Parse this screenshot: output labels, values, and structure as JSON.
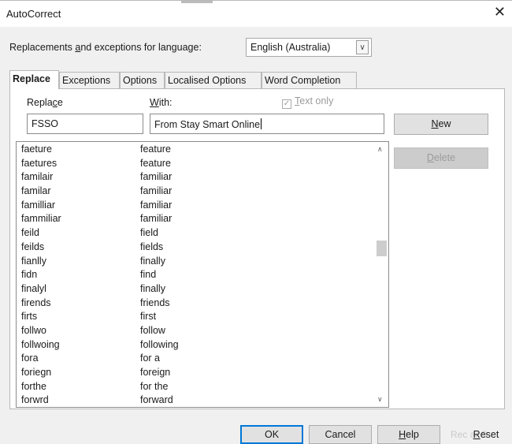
{
  "window": {
    "title": "AutoCorrect",
    "close_glyph": "✕"
  },
  "language": {
    "label_pre": "Replacements ",
    "label_mn": "a",
    "label_post": "nd exceptions for language:",
    "selected": "English (Australia)"
  },
  "tabs": [
    {
      "label": "Replace",
      "active": true
    },
    {
      "label": "Exceptions",
      "active": false
    },
    {
      "label": "Options",
      "active": false
    },
    {
      "label": "Localised Options",
      "active": false
    },
    {
      "label": "Word Completion",
      "active": false
    }
  ],
  "replace": {
    "replace_label_pre": "Repla",
    "replace_label_mn": "c",
    "replace_label_post": "e",
    "with_label_pre": "",
    "with_label_mn": "W",
    "with_label_post": "ith:",
    "text_only_mn": "T",
    "text_only_post": "ext only",
    "text_only_checked": true,
    "replace_value": "FSSO",
    "with_value": "From Stay Smart Online"
  },
  "buttons": {
    "new_mn": "N",
    "new_post": "ew",
    "delete_mn": "D",
    "delete_post": "elete",
    "ok": "OK",
    "cancel": "Cancel",
    "help_mn": "H",
    "help_post": "elp",
    "reset_mn": "R",
    "reset_post": "eset",
    "ghost_text": "Rec    ar S"
  },
  "entries": [
    [
      "faeture",
      "feature"
    ],
    [
      "faetures",
      "feature"
    ],
    [
      "familair",
      "familiar"
    ],
    [
      "familar",
      "familiar"
    ],
    [
      "familliar",
      "familiar"
    ],
    [
      "fammiliar",
      "familiar"
    ],
    [
      "feild",
      "field"
    ],
    [
      "feilds",
      "fields"
    ],
    [
      "fianlly",
      "finally"
    ],
    [
      "fidn",
      "find"
    ],
    [
      "finalyl",
      "finally"
    ],
    [
      "firends",
      "friends"
    ],
    [
      "firts",
      "first"
    ],
    [
      "follwo",
      "follow"
    ],
    [
      "follwoing",
      "following"
    ],
    [
      "fora",
      "for a"
    ],
    [
      "foriegn",
      "foreign"
    ],
    [
      "forthe",
      "for the"
    ],
    [
      "forwrd",
      "forward"
    ]
  ],
  "icons": {
    "dropdown": "chevron-down-icon",
    "scroll_up": "scroll-up-arrow-icon",
    "scroll_down": "scroll-down-arrow-icon",
    "check": "checkmark-icon"
  }
}
